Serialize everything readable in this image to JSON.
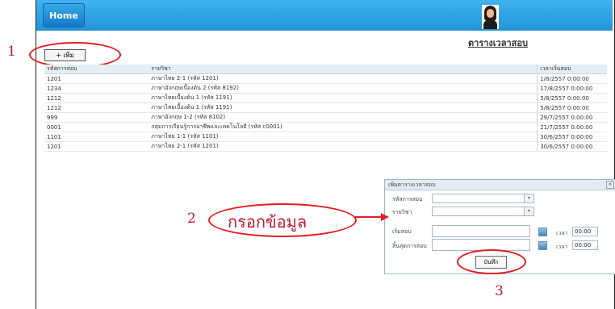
{
  "nav": {
    "home": "Home"
  },
  "page": {
    "title": "ตารางเวลาสอบ"
  },
  "toolbar": {
    "add_label": "+ เพิ่ม"
  },
  "table": {
    "headers": [
      "รหัสการสอบ",
      "รายวิชา",
      "เวลาเริ่มสอบ"
    ],
    "rows": [
      [
        "1201",
        "ภาษาไทย 2-1 (รหัส 1201)",
        "1/8/2557 0:00:00"
      ],
      [
        "1234",
        "ภาษาอังกฤษเบื้องต้น 2 (รหัส 8192)",
        "17/8/2557 0:00:00"
      ],
      [
        "1212",
        "ภาษาไทยเบื้องต้น 1 (รหัส 1191)",
        "5/8/2557 0:00:00"
      ],
      [
        "1212",
        "ภาษาไทยเบื้องต้น 1 (รหัส 1191)",
        "5/8/2557 0:00:00"
      ],
      [
        "999",
        "ภาษาอังกฤษ 1-2 (รหัส 8102)",
        "29/7/2557 0:00:00"
      ],
      [
        "0001",
        "กลุ่มการเรียนรู้การอาชีพและเทคโนโลยี (รหัส c0001)",
        "21/7/2557 0:00:00"
      ],
      [
        "1101",
        "ภาษาไทย 1-1 (รหัส 1101)",
        "30/6/2557 0:00:00"
      ],
      [
        "1201",
        "ภาษาไทย 2-1 (รหัส 1201)",
        "30/6/2557 0:00:00"
      ]
    ]
  },
  "dialog": {
    "title": "เพิ่มตารางเวลาสอบ",
    "close": "×",
    "fields": {
      "exam_code": "รหัสการสอบ",
      "subject": "รายวิชา",
      "start": "เริ่มสอบ",
      "end": "สิ้นสุดการสอบ"
    },
    "time_label": "เวลา",
    "start_time": "00:00",
    "end_time": "00:00",
    "save": "บันทึก"
  },
  "annotations": {
    "step1": "1",
    "step2": "2",
    "fill_label": "กรอกข้อมูล",
    "step3": "3"
  },
  "icons": {
    "dropdown": "chevron-down-icon",
    "calendar": "calendar-icon",
    "user": "user-avatar"
  },
  "colors": {
    "topbar": "#2aa3e6",
    "callout": "#e31b23"
  }
}
